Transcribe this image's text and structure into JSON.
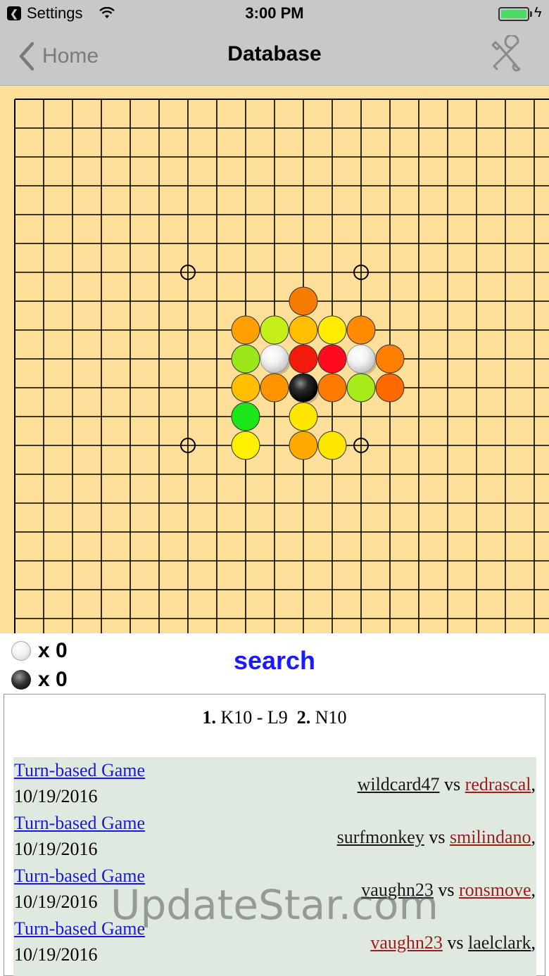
{
  "status_bar": {
    "back_app": "Settings",
    "time": "3:00 PM"
  },
  "nav": {
    "back_label": "Home",
    "title": "Database",
    "tools_icon": "tools-icon"
  },
  "board": {
    "size": 19,
    "background": "#fddf99",
    "star_points": [
      [
        6,
        6
      ],
      [
        12,
        6
      ],
      [
        6,
        12
      ],
      [
        12,
        12
      ]
    ],
    "stones": [
      {
        "col": 10,
        "row": 7,
        "color": "#f57c00"
      },
      {
        "col": 8,
        "row": 8,
        "color": "#ffa000"
      },
      {
        "col": 9,
        "row": 8,
        "color": "#c6ef1a"
      },
      {
        "col": 10,
        "row": 8,
        "color": "#ffbf00"
      },
      {
        "col": 11,
        "row": 8,
        "color": "#ffec00"
      },
      {
        "col": 12,
        "row": 8,
        "color": "#ff8c00"
      },
      {
        "col": 8,
        "row": 9,
        "color": "#9be81a"
      },
      {
        "col": 9,
        "row": 9,
        "color": "white"
      },
      {
        "col": 10,
        "row": 9,
        "color": "#f21a0a"
      },
      {
        "col": 11,
        "row": 9,
        "color": "#ff0a1e"
      },
      {
        "col": 12,
        "row": 9,
        "color": "white"
      },
      {
        "col": 13,
        "row": 9,
        "color": "#ff7f00"
      },
      {
        "col": 8,
        "row": 10,
        "color": "#ffbf00"
      },
      {
        "col": 9,
        "row": 10,
        "color": "#ff9400"
      },
      {
        "col": 10,
        "row": 10,
        "color": "black"
      },
      {
        "col": 11,
        "row": 10,
        "color": "#ff7c00"
      },
      {
        "col": 12,
        "row": 10,
        "color": "#a8ea1a"
      },
      {
        "col": 13,
        "row": 10,
        "color": "#ff6a00"
      },
      {
        "col": 8,
        "row": 11,
        "color": "#1ae61a"
      },
      {
        "col": 10,
        "row": 11,
        "color": "#ffe600"
      },
      {
        "col": 8,
        "row": 12,
        "color": "#fff000"
      },
      {
        "col": 10,
        "row": 12,
        "color": "#ffaa00"
      },
      {
        "col": 11,
        "row": 12,
        "color": "#ffe600"
      }
    ]
  },
  "captures": {
    "white": "x 0",
    "black": "x 0"
  },
  "search_label": "search",
  "moves": {
    "n1": "1.",
    "m1": "K10 - L9",
    "n2": "2.",
    "m2": "N10"
  },
  "games": [
    {
      "type": "Turn-based Game",
      "date": "10/19/2016",
      "p1": "wildcard47",
      "p1_style": "dark",
      "vs": "vs",
      "p2": "redrascal",
      "p2_style": "red",
      "trail": ","
    },
    {
      "type": "Turn-based Game",
      "date": "10/19/2016",
      "p1": "surfmonkey",
      "p1_style": "dark",
      "vs": "vs",
      "p2": "smilindano",
      "p2_style": "red",
      "trail": ","
    },
    {
      "type": "Turn-based Game",
      "date": "10/19/2016",
      "p1": "vaughn23",
      "p1_style": "dark",
      "vs": "vs",
      "p2": "ronsmove",
      "p2_style": "red",
      "trail": ","
    },
    {
      "type": "Turn-based Game",
      "date": "10/19/2016",
      "p1": "vaughn23",
      "p1_style": "red",
      "vs": "vs",
      "p2": "laelclark",
      "p2_style": "dark",
      "trail": ","
    }
  ],
  "watermark": "UpdateStar.com"
}
